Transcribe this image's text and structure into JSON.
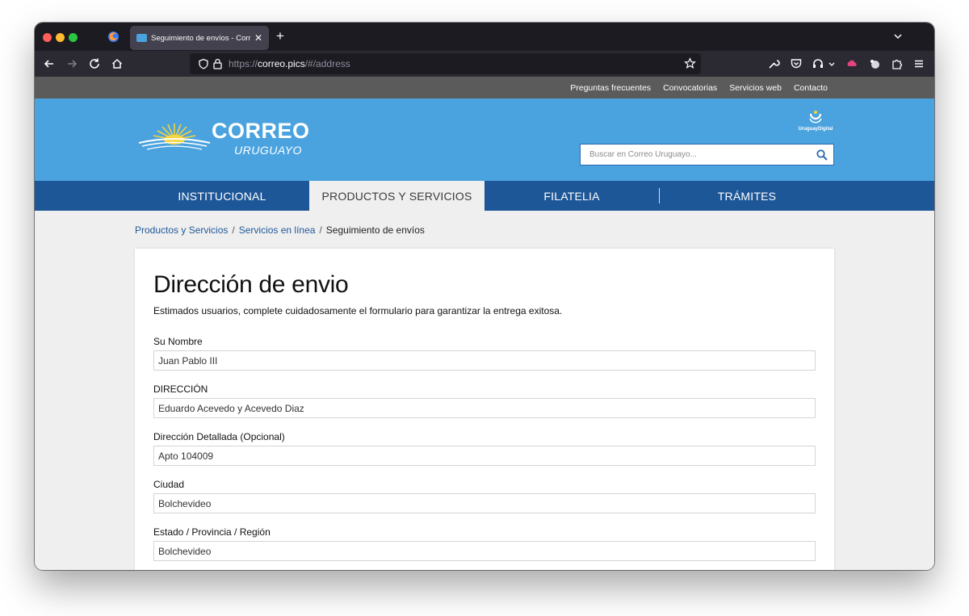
{
  "browser": {
    "tab_title": "Seguimiento de envíos - Correo Uruguayo",
    "url_prefix": "https://",
    "url_host": "correo.pics",
    "url_path": "/#/address"
  },
  "utility_nav": [
    "Preguntas frecuentes",
    "Convocatorias",
    "Servicios web",
    "Contacto"
  ],
  "header": {
    "logo_main": "CORREO",
    "logo_sub": "URUGUAYO",
    "partner_logo_text": "UruguayDigital",
    "search_placeholder": "Buscar en Correo Uruguayo..."
  },
  "main_nav": [
    {
      "label": "INSTITUCIONAL",
      "active": false
    },
    {
      "label": "PRODUCTOS Y SERVICIOS",
      "active": true
    },
    {
      "label": "FILATELIA",
      "active": false
    },
    {
      "label": "TRÁMITES",
      "active": false
    }
  ],
  "breadcrumb": {
    "items": [
      "Productos y Servicios",
      "Servicios en línea"
    ],
    "separator": "/",
    "current": "Seguimiento de envíos"
  },
  "form": {
    "title": "Dirección de envio",
    "intro": "Estimados usuarios, complete cuidadosamente el formulario para garantizar la entrega exitosa.",
    "fields": [
      {
        "label": "Su Nombre",
        "value": "Juan Pablo III"
      },
      {
        "label": "DIRECCIÓN",
        "value": "Eduardo Acevedo y Acevedo Diaz"
      },
      {
        "label": "Dirección Detallada (Opcional)",
        "value": "Apto 104009"
      },
      {
        "label": "Ciudad",
        "value": "Bolchevideo"
      },
      {
        "label": "Estado / Provincia / Región",
        "value": "Bolchevideo"
      }
    ]
  },
  "colors": {
    "header_blue": "#4aa3df",
    "nav_blue": "#1e5798",
    "utility_gray": "#5b5b5b"
  }
}
